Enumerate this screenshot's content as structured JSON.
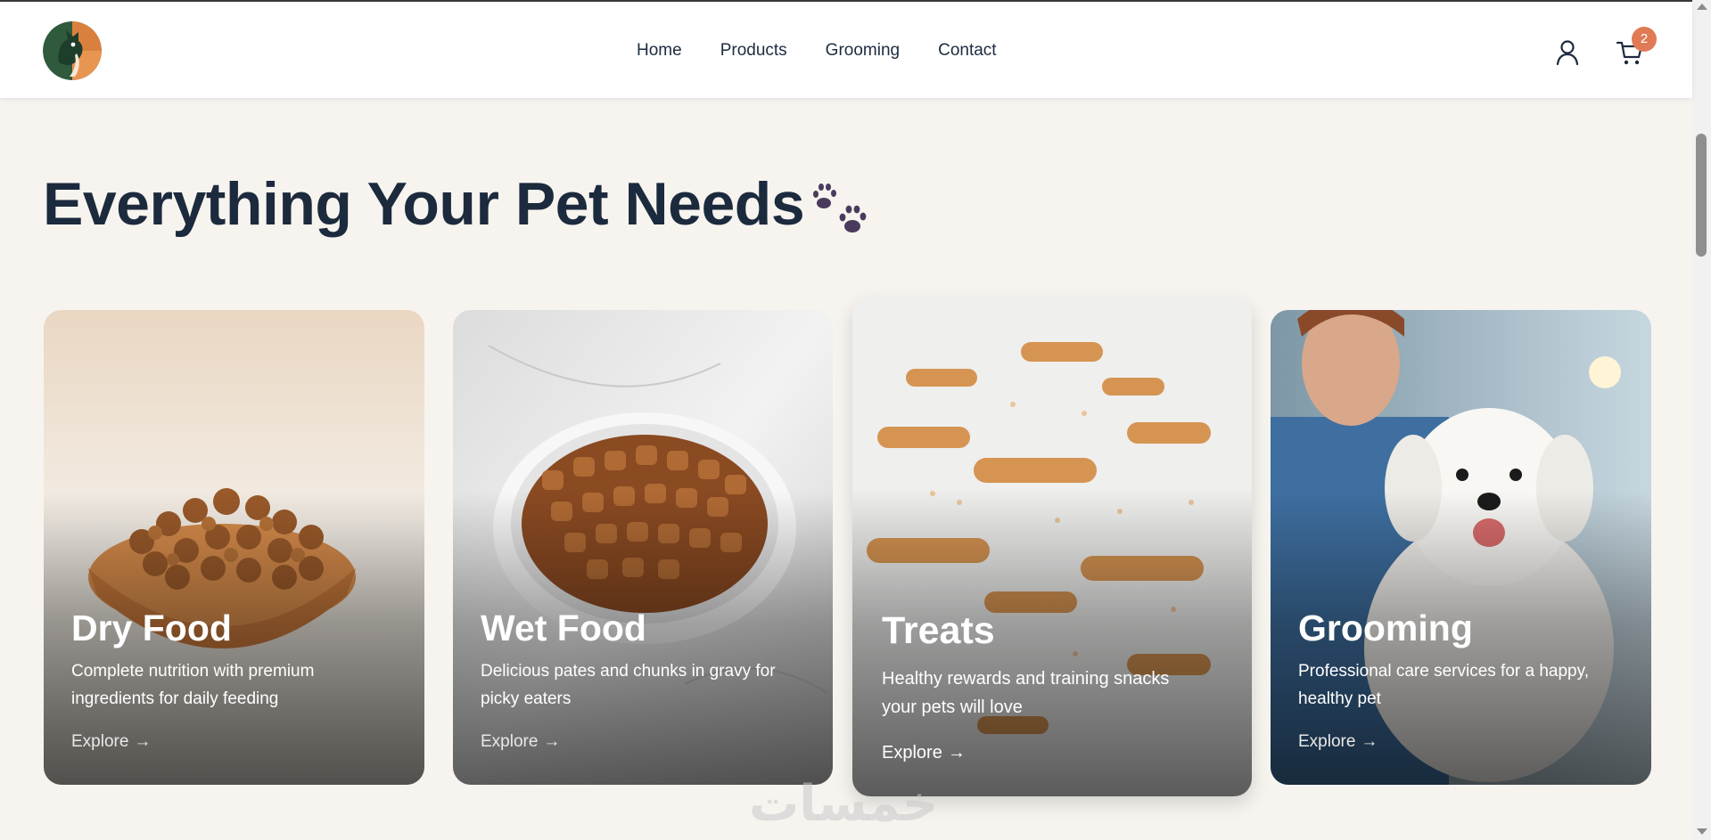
{
  "header": {
    "logo_name": "pet-store-logo",
    "nav": [
      {
        "label": "Home"
      },
      {
        "label": "Products"
      },
      {
        "label": "Grooming"
      },
      {
        "label": "Contact"
      }
    ],
    "cart_count": "2",
    "icons": {
      "user": "user-icon",
      "cart": "cart-icon"
    }
  },
  "main": {
    "title": "Everything Your Pet Needs",
    "title_icon": "paw-prints-icon",
    "cards": [
      {
        "title": "Dry Food",
        "description": "Complete nutrition with premium ingredients for daily feeding",
        "link": "Explore"
      },
      {
        "title": "Wet Food",
        "description": "Delicious pates and chunks in gravy for picky eaters",
        "link": "Explore"
      },
      {
        "title": "Treats",
        "description": "Healthy rewards and training snacks your pets will love",
        "link": "Explore"
      },
      {
        "title": "Grooming",
        "description": "Professional care services for a happy, healthy pet",
        "link": "Explore"
      }
    ]
  },
  "watermark": "خمسات",
  "colors": {
    "background": "#f7f4f0",
    "heading": "#1c2a3d",
    "accent": "#e07a55",
    "paw": "#4a3a5c"
  }
}
